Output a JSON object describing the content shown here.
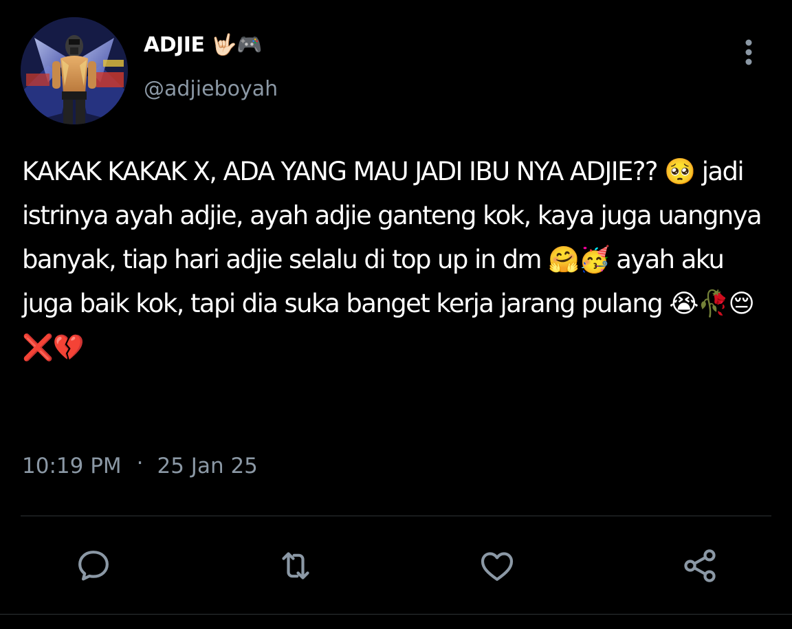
{
  "author": {
    "display_name": "ADJIE 🤟🏻🎮",
    "handle": "@adjieboyah"
  },
  "tweet": {
    "text": "KAKAK KAKAK X, ADA YANG MAU JADI IBU NYA ADJIE?? 🥺 jadi istrinya ayah adjie, ayah adjie ganteng kok, kaya juga uangnya banyak, tiap hari adjie selalu di top up in dm 🤗🥳 ayah aku juga baik kok, tapi dia suka banget kerja jarang pulang 😭🥀😔❌💔",
    "time": "10:19 PM",
    "separator": "·",
    "date": "25 Jan 25"
  },
  "icons": {
    "more": "more-vertical-icon",
    "reply": "reply-icon",
    "retweet": "retweet-icon",
    "like": "heart-icon",
    "share": "share-icon"
  },
  "colors": {
    "background": "#000000",
    "text": "#ffffff",
    "secondary": "#8b98a5",
    "divider": "#2f3336"
  }
}
